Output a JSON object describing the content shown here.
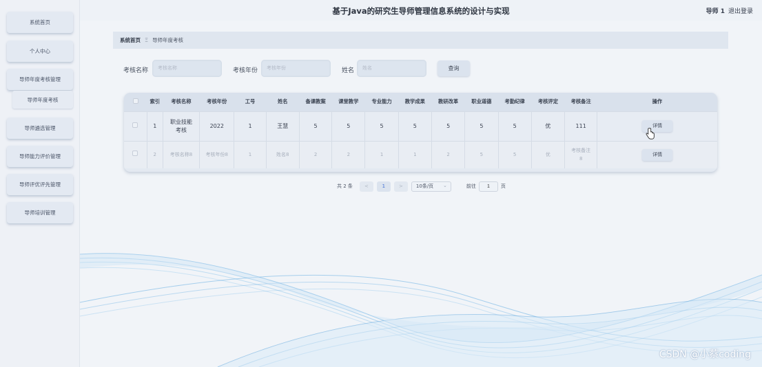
{
  "header": {
    "title": "基于Java的研究生导师管理信息系统的设计与实现",
    "user": "导师 1",
    "logout": "退出登录"
  },
  "sidebar": {
    "items": [
      {
        "label": "系统首页"
      },
      {
        "label": "个人中心"
      },
      {
        "label": "导师年度考核管理"
      },
      {
        "label": "导师年度考核"
      },
      {
        "label": "导师遴选管理"
      },
      {
        "label": "导师能力评价管理"
      },
      {
        "label": "导师评优评先管理"
      },
      {
        "label": "导师培训管理"
      }
    ]
  },
  "breadcrumb": {
    "home": "系统首页",
    "separator": "Ξ",
    "current": "导师年度考核"
  },
  "search": {
    "fields": [
      {
        "label": "考核名称",
        "placeholder": "考核名称"
      },
      {
        "label": "考核年份",
        "placeholder": "考核年份"
      },
      {
        "label": "姓名",
        "placeholder": "姓名"
      }
    ],
    "button": "查询"
  },
  "table": {
    "columns": [
      "索引",
      "考核名称",
      "考核年份",
      "工号",
      "姓名",
      "备课教案",
      "课堂教学",
      "专业能力",
      "教学成果",
      "教研改革",
      "职业道德",
      "考勤纪律",
      "考核评定",
      "考核备注",
      "操作"
    ],
    "rows": [
      {
        "index": "1",
        "name": "职业技能考核",
        "year": "2022",
        "job_no": "1",
        "person": "王慧",
        "prep": "5",
        "teaching": "5",
        "ability": "5",
        "results": "5",
        "reform": "5",
        "ethics": "5",
        "attendance": "5",
        "grade": "优",
        "remark": "111",
        "action": "详情"
      },
      {
        "index": "2",
        "name": "考核名称8",
        "year": "考核年份8",
        "job_no": "1",
        "person": "姓名8",
        "prep": "2",
        "teaching": "2",
        "ability": "1",
        "results": "1",
        "reform": "2",
        "ethics": "5",
        "attendance": "5",
        "grade": "优",
        "remark": "考核备注8",
        "action": "详情"
      }
    ]
  },
  "pagination": {
    "total": "共 2 条",
    "prev": "<",
    "current_page": "1",
    "next": ">",
    "page_size": "10条/页",
    "goto_label": "前往",
    "goto_value": "1",
    "page_suffix": "页"
  },
  "watermark": "CSDN @小蔡coding",
  "colors": {
    "accent": "#3f6fd6",
    "wave": "#4aa3df"
  }
}
